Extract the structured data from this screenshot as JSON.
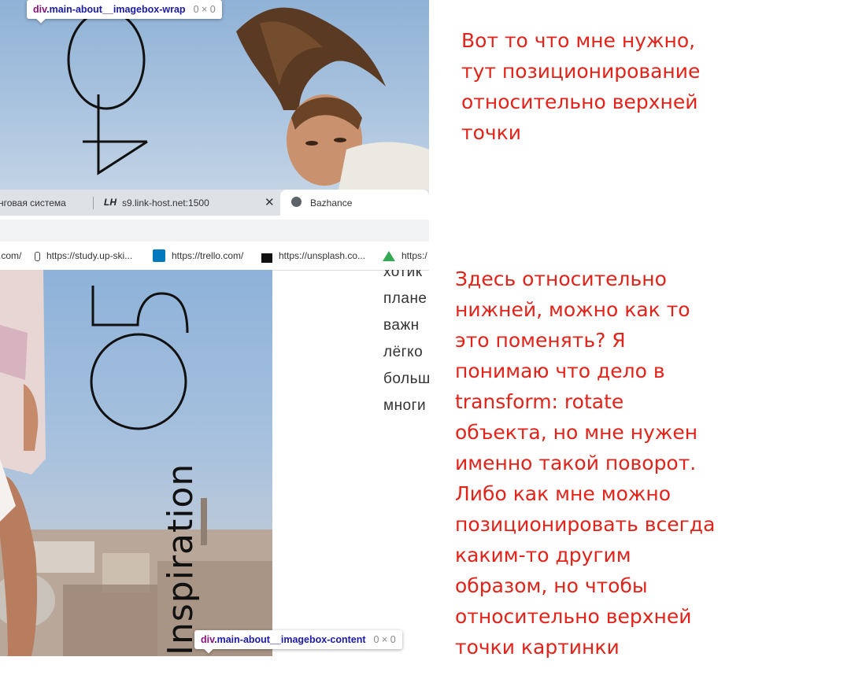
{
  "devtools": {
    "top_tooltip": {
      "tag": "div",
      "class": ".main-about__imagebox-wrap",
      "size": "0 × 0"
    },
    "bottom_tooltip": {
      "tag": "div",
      "class": ".main-about__imagebox-content",
      "size": "0 × 0"
    }
  },
  "top_photo": {
    "big_digits": "40"
  },
  "browser": {
    "tabs": [
      {
        "label": "нговая система"
      },
      {
        "label": "s9.link-host.net:1500",
        "icon": "lh-logo-icon"
      },
      {
        "label": "Bazhance",
        "icon": "globe-icon",
        "active": true
      }
    ],
    "bookmarks": [
      {
        "label": ".com/",
        "icon": "pin-icon"
      },
      {
        "label": "https://study.up-ski...",
        "icon": "trello-icon"
      },
      {
        "label": "https://trello.com/",
        "icon": "unsplash-icon"
      },
      {
        "label": "https://unsplash.co...",
        "icon": "drive-icon"
      },
      {
        "label": "https:/"
      }
    ]
  },
  "bottom_photo": {
    "big_digits": "05",
    "vertical_word": "Inspiration"
  },
  "page_text_fragments": [
    "хотик",
    "плане",
    "важн",
    "лёгко",
    "больш",
    "многи"
  ],
  "annotations": {
    "top": [
      "Вот то что мне нужно,",
      "тут позиционирование",
      "относительно верхней",
      "точки"
    ],
    "bottom": [
      "Здесь относительно",
      "нижней, можно как то",
      "это поменять? Я",
      "понимаю что дело в",
      "transform: rotate",
      "объекта, но мне нужен",
      "именно такой поворот.",
      "Либо как мне можно",
      "позиционировать всегда",
      "каким-то другим",
      "образом, но чтобы",
      "относительно верхней",
      "точки картинки"
    ]
  },
  "colors": {
    "annotation": "#e2231a",
    "devtools_tag": "#881280",
    "devtools_class": "#1a1aa6"
  }
}
